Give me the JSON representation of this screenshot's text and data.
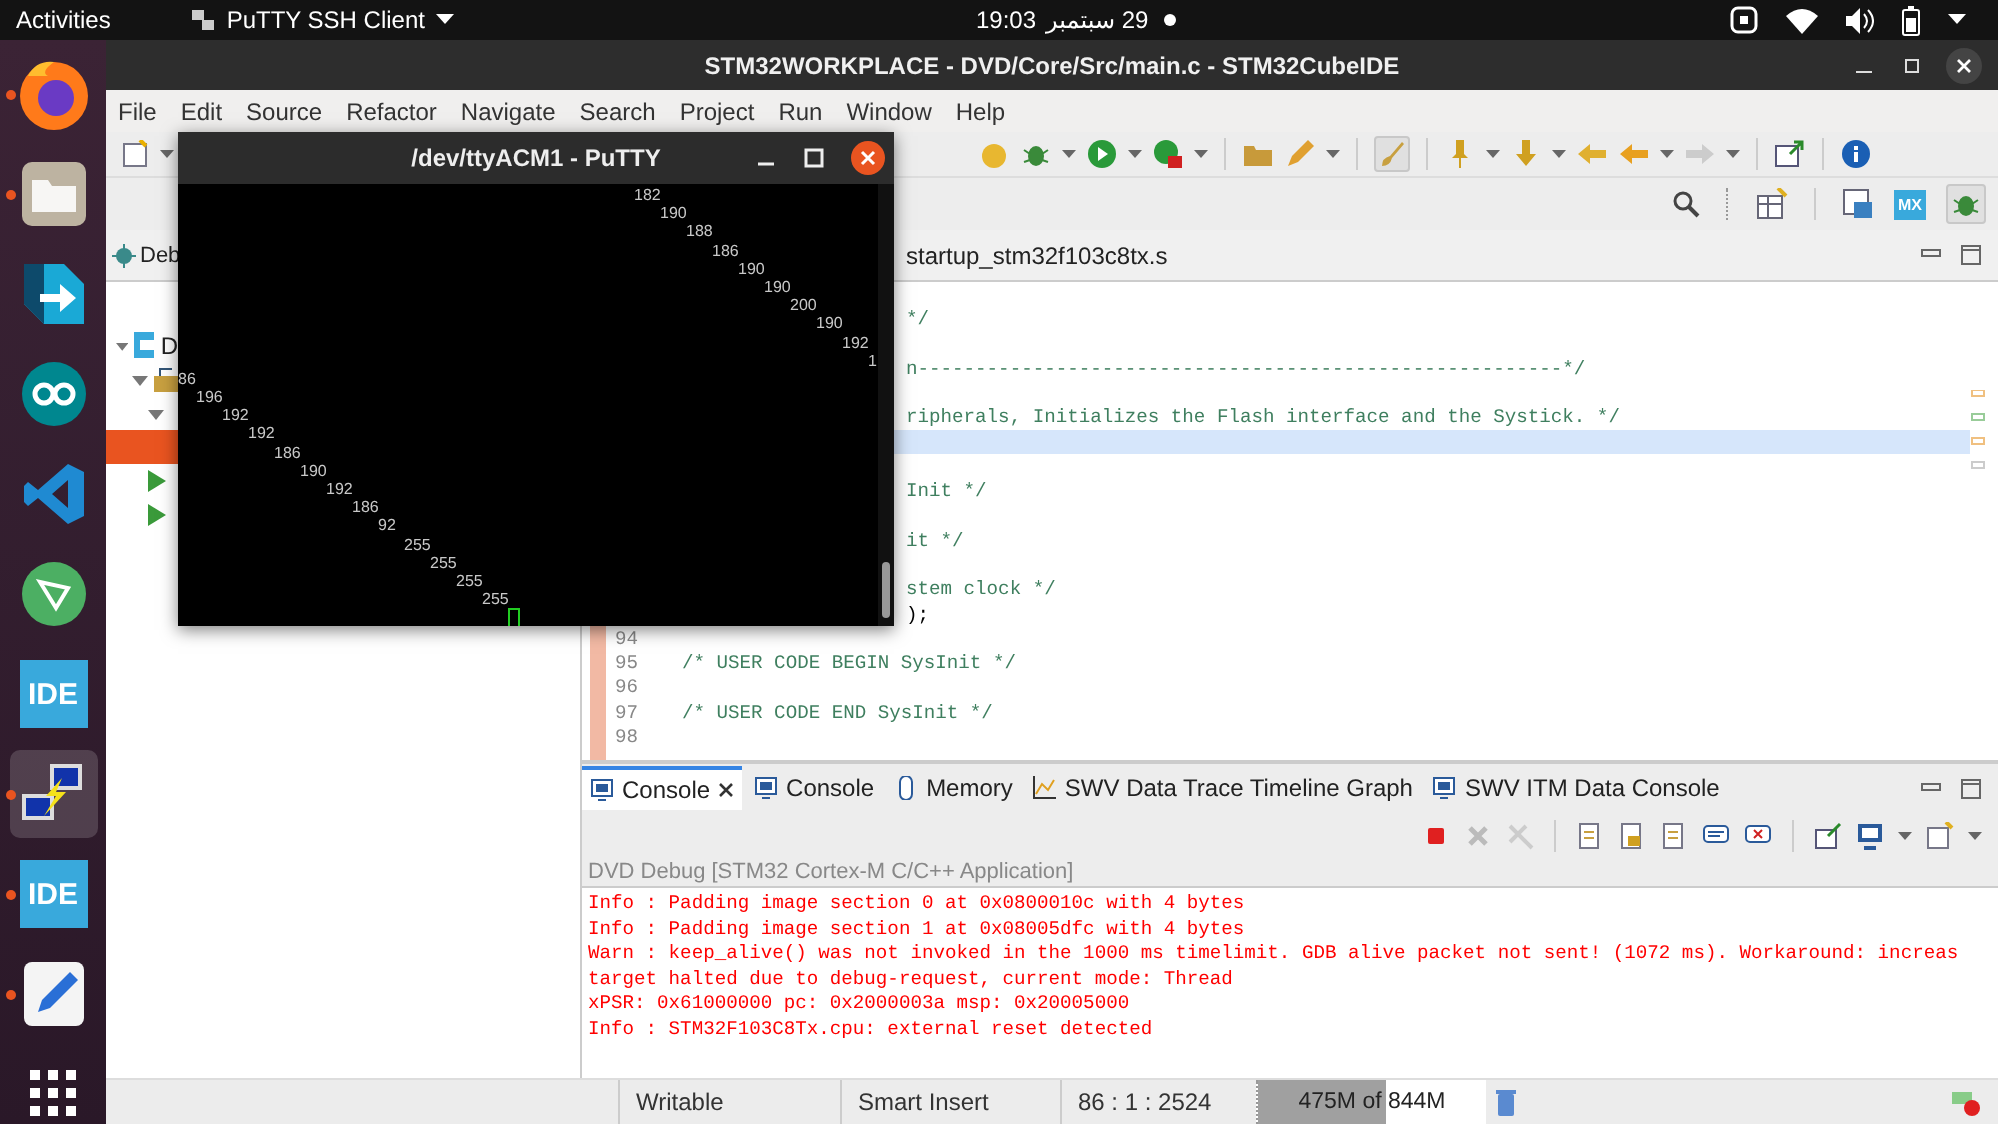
{
  "topbar": {
    "activities": "Activities",
    "app_menu": "PuTTY SSH Client",
    "time": "19:03",
    "date": "29 سبتمبر"
  },
  "dock": [
    {
      "kind": "firefox",
      "running": true,
      "selected": false
    },
    {
      "kind": "files",
      "running": true,
      "selected": false
    },
    {
      "kind": "transfer",
      "running": false,
      "selected": false
    },
    {
      "kind": "arduino",
      "running": false,
      "selected": false
    },
    {
      "kind": "vscode",
      "running": false,
      "selected": false
    },
    {
      "kind": "graph",
      "running": false,
      "selected": false
    },
    {
      "kind": "ide",
      "label": "IDE",
      "running": false,
      "selected": false
    },
    {
      "kind": "putty",
      "running": true,
      "selected": true
    },
    {
      "kind": "ide",
      "label": "IDE",
      "running": true,
      "selected": false
    },
    {
      "kind": "editor",
      "running": true,
      "selected": false
    },
    {
      "kind": "apps",
      "running": false,
      "selected": false
    }
  ],
  "window": {
    "title": "STM32WORKPLACE - DVD/Core/Src/main.c - STM32CubeIDE"
  },
  "menu": [
    "File",
    "Edit",
    "Source",
    "Refactor",
    "Navigate",
    "Search",
    "Project",
    "Run",
    "Window",
    "Help"
  ],
  "perspective_toolbar": {
    "mx_label": "MX"
  },
  "debug_view": {
    "tab": "Deb",
    "tree": [
      {
        "label": "D",
        "kind": "project",
        "expanded": true,
        "selected": false,
        "children": [
          {
            "kind": "launcher",
            "expanded": true,
            "selected": false,
            "children": [
              {
                "expanded": true,
                "selected": false,
                "children": [
                  {
                    "selected": true
                  }
                ]
              },
              {
                "kind": "thread",
                "selected": false
              },
              {
                "kind": "thread",
                "selected": false
              }
            ]
          }
        ]
      }
    ]
  },
  "editor": {
    "tab": "startup_stm32f103c8tx.s",
    "lines": [
      {
        "current": false
      },
      {
        "kind": "clipped",
        "text": "*/",
        "comment": true,
        "current": false
      },
      {
        "current": false
      },
      {
        "kind": "clipped",
        "text": "n--------------------------------------------------------*/",
        "comment": true,
        "current": false
      },
      {
        "current": false
      },
      {
        "kind": "clipped",
        "text": "ripherals, Initializes the Flash interface and the Systick. */",
        "comment": true,
        "current": false
      },
      {
        "current": true
      },
      {
        "current": false
      },
      {
        "kind": "clipped",
        "text": "Init */",
        "comment": true,
        "current": false
      },
      {
        "current": false
      },
      {
        "kind": "clipped",
        "text": "it */",
        "comment": true,
        "current": false
      },
      {
        "current": false
      },
      {
        "kind": "clipped",
        "text": "stem clock */",
        "comment": true,
        "current": false
      },
      {
        "kind": "clipped",
        "text": ");",
        "comment": false,
        "current": false
      },
      {
        "number": "94",
        "current": false
      },
      {
        "kind": "full",
        "number": "95",
        "text": "/* USER CODE BEGIN SysInit */",
        "comment": true,
        "current": false
      },
      {
        "number": "96",
        "current": false
      },
      {
        "kind": "full",
        "number": "97",
        "text": "/* USER CODE END SysInit */",
        "comment": true,
        "current": false
      },
      {
        "number": "98",
        "current": false
      }
    ]
  },
  "console": {
    "tabs": [
      {
        "label": "Console",
        "kind": "console",
        "selected": true,
        "closable": true
      },
      {
        "label": "Console",
        "kind": "console",
        "selected": false,
        "closable": false
      },
      {
        "label": "Memory",
        "kind": "memory",
        "selected": false,
        "closable": false
      },
      {
        "label": "SWV Data Trace Timeline Graph",
        "kind": "graph",
        "selected": false,
        "closable": false
      },
      {
        "label": "SWV ITM Data Console",
        "kind": "console",
        "selected": false,
        "closable": false
      }
    ],
    "launch": "DVD Debug [STM32 Cortex-M C/C++ Application]",
    "lines": [
      "Info : Padding image section 0 at 0x0800010c with 4 bytes",
      "Info : Padding image section 1 at 0x08005dfc with 4 bytes",
      "Warn : keep_alive() was not invoked in the 1000 ms timelimit. GDB alive packet not sent! (1072 ms). Workaround: increas",
      "target halted due to debug-request, current mode: Thread",
      "xPSR: 0x61000000 pc: 0x2000003a msp: 0x20005000",
      "Info : STM32F103C8Tx.cpu: external reset detected"
    ]
  },
  "status_bar": {
    "mode": "Writable",
    "insert": "Smart Insert",
    "position": "86 : 1 : 2524",
    "heap": {
      "reading": "475M of 844M",
      "level": 0.5628
    }
  },
  "putty": {
    "title": "/dev/ttyACM1 - PuTTY",
    "top_lines": [
      "182",
      "190",
      "188",
      "186",
      "190",
      "190",
      "200",
      "190",
      "192",
      "1"
    ],
    "bottom_lines": [
      "86",
      "196",
      "192",
      "192",
      "186",
      "190",
      "192",
      "186",
      "92",
      "255",
      "255",
      "255",
      "255"
    ],
    "cursor_visible": true
  }
}
